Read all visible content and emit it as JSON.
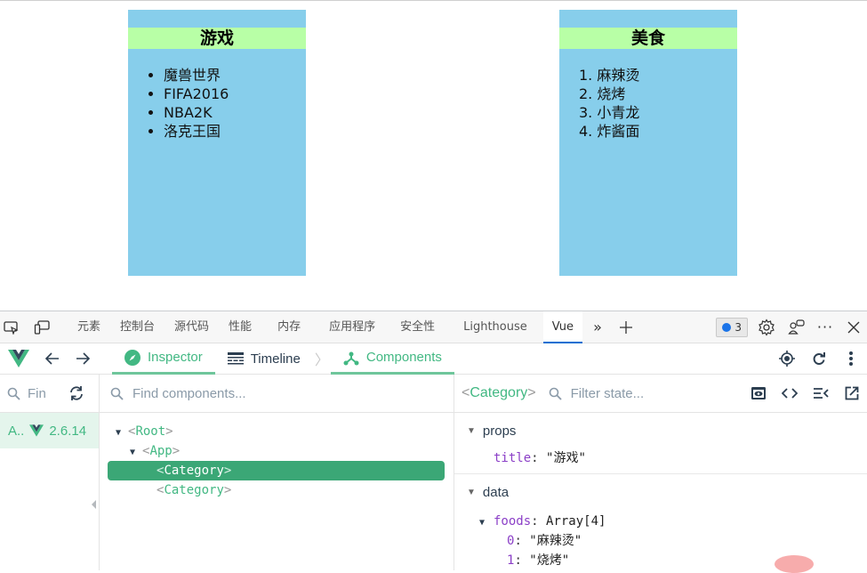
{
  "page": {
    "categories": [
      {
        "title": "游戏",
        "list_type": "unordered",
        "items": [
          "魔兽世界",
          "FIFA2016",
          "NBA2K",
          "洛克王国"
        ]
      },
      {
        "title": "美食",
        "list_type": "ordered",
        "items": [
          "1. 麻辣烫",
          "2. 烧烤",
          "3. 小青龙",
          "4. 炸酱面"
        ]
      }
    ],
    "colors": {
      "card_bg": "#87ceeb",
      "title_bg": "#b8ffa6"
    }
  },
  "devtools": {
    "tabs": [
      {
        "label": "元素"
      },
      {
        "label": "控制台"
      },
      {
        "label": "源代码"
      },
      {
        "label": "性能"
      },
      {
        "label": "内存"
      },
      {
        "label": "应用程序"
      },
      {
        "label": "安全性"
      },
      {
        "label": "Lighthouse"
      },
      {
        "label": "Vue",
        "active": true
      }
    ],
    "issues_count": "3"
  },
  "vue": {
    "tabs": {
      "inspector": "Inspector",
      "timeline": "Timeline",
      "components": "Components"
    },
    "app_search_placeholder": "Find apps...",
    "app_search_visible": "Fin",
    "app": {
      "name": "A..",
      "version": "2.6.14"
    },
    "component_search_placeholder": "Find components...",
    "tree": [
      {
        "label": "Root",
        "depth": 0,
        "expanded": true
      },
      {
        "label": "App",
        "depth": 1,
        "expanded": true
      },
      {
        "label": "Category",
        "depth": 2,
        "selected": true
      },
      {
        "label": "Category",
        "depth": 2
      }
    ],
    "selected_component": "Category",
    "state_filter_placeholder": "Filter state...",
    "state": {
      "props_label": "props",
      "props": [
        {
          "key": "title",
          "value": "\"游戏\""
        }
      ],
      "data_label": "data",
      "foods_key": "foods",
      "foods_type": "Array[4]",
      "foods_items": [
        {
          "key": "0",
          "value": "\"麻辣烫\""
        },
        {
          "key": "1",
          "value": "\"烧烤\""
        }
      ]
    },
    "accent": "#42b883"
  }
}
